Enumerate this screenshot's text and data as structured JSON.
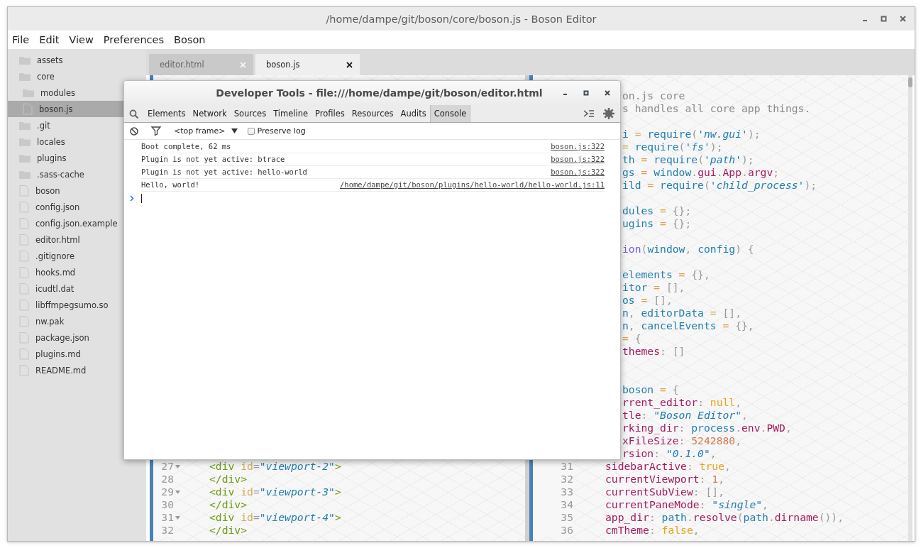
{
  "window": {
    "title": "/home/dampe/git/boson/core/boson.js - Boson Editor"
  },
  "menu": [
    "File",
    "Edit",
    "View",
    "Preferences",
    "Boson"
  ],
  "sidebar": {
    "items": [
      {
        "label": "assets",
        "kind": "folder",
        "selected": false
      },
      {
        "label": "core",
        "kind": "folder",
        "selected": false,
        "children": [
          {
            "label": "modules",
            "kind": "folder",
            "selected": false
          },
          {
            "label": "boson.js",
            "kind": "file",
            "selected": true
          }
        ]
      },
      {
        "label": ".git",
        "kind": "folder",
        "selected": false
      },
      {
        "label": "locales",
        "kind": "folder",
        "selected": false
      },
      {
        "label": "plugins",
        "kind": "folder",
        "selected": false
      },
      {
        "label": ".sass-cache",
        "kind": "folder",
        "selected": false
      },
      {
        "label": "boson",
        "kind": "file",
        "selected": false
      },
      {
        "label": "config.json",
        "kind": "file",
        "selected": false
      },
      {
        "label": "config.json.example",
        "kind": "file",
        "selected": false
      },
      {
        "label": "editor.html",
        "kind": "file",
        "selected": false
      },
      {
        "label": ".gitignore",
        "kind": "file",
        "selected": false
      },
      {
        "label": "hooks.md",
        "kind": "file",
        "selected": false
      },
      {
        "label": "icudtl.dat",
        "kind": "file",
        "selected": false
      },
      {
        "label": "libffmpegsumo.so",
        "kind": "file",
        "selected": false
      },
      {
        "label": "nw.pak",
        "kind": "file",
        "selected": false
      },
      {
        "label": "package.json",
        "kind": "file",
        "selected": false
      },
      {
        "label": "plugins.md",
        "kind": "file",
        "selected": false
      },
      {
        "label": "README.md",
        "kind": "file",
        "selected": false
      }
    ]
  },
  "tabs": [
    {
      "label": "editor.html",
      "selected": false
    },
    {
      "label": "boson.js",
      "selected": true
    }
  ],
  "editors": [
    {
      "lines": [
        {
          "number": "27",
          "foldable": true,
          "tokens": [
            {
              "kind": "tag",
              "text": "<div"
            },
            {
              "kind": "attr",
              "text": " id"
            },
            {
              "kind": "punct",
              "text": "="
            },
            {
              "kind": "string",
              "text": "\"viewport-2\""
            },
            {
              "kind": "tag",
              "text": ">"
            }
          ]
        },
        {
          "number": "28",
          "foldable": false,
          "tokens": [
            {
              "kind": "tag",
              "text": "</div>"
            }
          ]
        },
        {
          "number": "29",
          "foldable": true,
          "tokens": [
            {
              "kind": "tag",
              "text": "<div"
            },
            {
              "kind": "attr",
              "text": " id"
            },
            {
              "kind": "punct",
              "text": "="
            },
            {
              "kind": "string",
              "text": "\"viewport-3\""
            },
            {
              "kind": "tag",
              "text": ">"
            }
          ]
        },
        {
          "number": "30",
          "foldable": false,
          "tokens": [
            {
              "kind": "tag",
              "text": "</div>"
            }
          ]
        },
        {
          "number": "31",
          "foldable": true,
          "tokens": [
            {
              "kind": "tag",
              "text": "<div"
            },
            {
              "kind": "attr",
              "text": " id"
            },
            {
              "kind": "punct",
              "text": "="
            },
            {
              "kind": "string",
              "text": "\"viewport-4\""
            },
            {
              "kind": "tag",
              "text": ">"
            }
          ]
        },
        {
          "number": "32",
          "foldable": false,
          "tokens": [
            {
              "kind": "tag",
              "text": "</div>"
            }
          ]
        }
      ]
    },
    {
      "lines": [
        {
          "tokens": [
            {
              "kind": "comment",
              "text": "on.js core"
            }
          ]
        },
        {
          "tokens": [
            {
              "kind": "comment",
              "text": "s handles all core app things."
            }
          ]
        },
        {
          "kind": "blank"
        },
        {
          "tokens": [
            {
              "kind": "def",
              "text": "i"
            },
            {
              "kind": "op",
              "text": " = "
            },
            {
              "kind": "def",
              "text": "require"
            },
            {
              "kind": "punct",
              "text": "("
            },
            {
              "kind": "string",
              "text": "'nw.gui'"
            },
            {
              "kind": "punct",
              "text": ");"
            }
          ]
        },
        {
          "tokens": [
            {
              "kind": "op",
              "text": "= "
            },
            {
              "kind": "def",
              "text": "require"
            },
            {
              "kind": "punct",
              "text": "("
            },
            {
              "kind": "string",
              "text": "'fs'"
            },
            {
              "kind": "punct",
              "text": ");"
            }
          ]
        },
        {
          "tokens": [
            {
              "kind": "def",
              "text": "th"
            },
            {
              "kind": "op",
              "text": " = "
            },
            {
              "kind": "def",
              "text": "require"
            },
            {
              "kind": "punct",
              "text": "("
            },
            {
              "kind": "string",
              "text": "'path'"
            },
            {
              "kind": "punct",
              "text": ");"
            }
          ]
        },
        {
          "tokens": [
            {
              "kind": "def",
              "text": "gs"
            },
            {
              "kind": "op",
              "text": " = "
            },
            {
              "kind": "def",
              "text": "window"
            },
            {
              "kind": "punct",
              "text": "."
            },
            {
              "kind": "prop",
              "text": "gui"
            },
            {
              "kind": "punct",
              "text": "."
            },
            {
              "kind": "prop",
              "text": "App"
            },
            {
              "kind": "punct",
              "text": "."
            },
            {
              "kind": "prop",
              "text": "argv"
            },
            {
              "kind": "punct",
              "text": ";"
            }
          ]
        },
        {
          "tokens": [
            {
              "kind": "def",
              "text": "ild"
            },
            {
              "kind": "op",
              "text": " = "
            },
            {
              "kind": "def",
              "text": "require"
            },
            {
              "kind": "punct",
              "text": "("
            },
            {
              "kind": "string",
              "text": "'child_process'"
            },
            {
              "kind": "punct",
              "text": ");"
            }
          ]
        },
        {
          "kind": "blank"
        },
        {
          "tokens": [
            {
              "kind": "def",
              "text": "dules"
            },
            {
              "kind": "op",
              "text": " = "
            },
            {
              "kind": "punct",
              "text": "{};"
            }
          ]
        },
        {
          "tokens": [
            {
              "kind": "def",
              "text": "ugins"
            },
            {
              "kind": "op",
              "text": " = "
            },
            {
              "kind": "punct",
              "text": "{};"
            }
          ]
        },
        {
          "kind": "blank"
        },
        {
          "tokens": [
            {
              "kind": "keyword",
              "text": "ion"
            },
            {
              "kind": "punct",
              "text": "("
            },
            {
              "kind": "def",
              "text": "window"
            },
            {
              "kind": "punct",
              "text": ", "
            },
            {
              "kind": "def",
              "text": "config"
            },
            {
              "kind": "punct",
              "text": ") {"
            }
          ]
        },
        {
          "kind": "blank"
        },
        {
          "tokens": [
            {
              "kind": "def",
              "text": "elements"
            },
            {
              "kind": "op",
              "text": " = "
            },
            {
              "kind": "punct",
              "text": "{},"
            }
          ]
        },
        {
          "tokens": [
            {
              "kind": "def",
              "text": "itor"
            },
            {
              "kind": "op",
              "text": " = "
            },
            {
              "kind": "punct",
              "text": "[],"
            }
          ]
        },
        {
          "tokens": [
            {
              "kind": "def",
              "text": "os"
            },
            {
              "kind": "op",
              "text": " = "
            },
            {
              "kind": "punct",
              "text": "[],"
            }
          ]
        },
        {
          "tokens": [
            {
              "kind": "def",
              "text": "n"
            },
            {
              "kind": "punct",
              "text": ", "
            },
            {
              "kind": "def",
              "text": "editorData"
            },
            {
              "kind": "op",
              "text": " = "
            },
            {
              "kind": "punct",
              "text": "[],"
            }
          ]
        },
        {
          "tokens": [
            {
              "kind": "def",
              "text": "n"
            },
            {
              "kind": "punct",
              "text": ", "
            },
            {
              "kind": "def",
              "text": "cancelEvents"
            },
            {
              "kind": "op",
              "text": " = "
            },
            {
              "kind": "punct",
              "text": "{},"
            }
          ]
        },
        {
          "tokens": [
            {
              "kind": "op",
              "text": "= "
            },
            {
              "kind": "punct",
              "text": "{"
            }
          ]
        },
        {
          "tokens": [
            {
              "kind": "prop",
              "text": "themes"
            },
            {
              "kind": "punct",
              "text": ": []"
            }
          ]
        },
        {
          "kind": "blank"
        },
        {
          "kind": "blank"
        },
        {
          "tokens": [
            {
              "kind": "def",
              "text": "boson"
            },
            {
              "kind": "op",
              "text": " = "
            },
            {
              "kind": "punct",
              "text": "{"
            }
          ]
        },
        {
          "tokens": [
            {
              "kind": "prop",
              "text": "rrent_editor"
            },
            {
              "kind": "punct",
              "text": ": "
            },
            {
              "kind": "atom",
              "text": "null"
            },
            {
              "kind": "punct",
              "text": ","
            }
          ]
        },
        {
          "tokens": [
            {
              "kind": "prop",
              "text": "tle"
            },
            {
              "kind": "punct",
              "text": ": "
            },
            {
              "kind": "string",
              "text": "\"Boson Editor\""
            },
            {
              "kind": "punct",
              "text": ","
            }
          ]
        },
        {
          "tokens": [
            {
              "kind": "prop",
              "text": "rking_dir"
            },
            {
              "kind": "punct",
              "text": ": "
            },
            {
              "kind": "def",
              "text": "process"
            },
            {
              "kind": "punct",
              "text": "."
            },
            {
              "kind": "prop",
              "text": "env"
            },
            {
              "kind": "punct",
              "text": "."
            },
            {
              "kind": "prop",
              "text": "PWD"
            },
            {
              "kind": "punct",
              "text": ","
            }
          ]
        },
        {
          "tokens": [
            {
              "kind": "prop",
              "text": "xFileSize"
            },
            {
              "kind": "punct",
              "text": ": "
            },
            {
              "kind": "number",
              "text": "5242880"
            },
            {
              "kind": "punct",
              "text": ","
            }
          ]
        },
        {
          "tokens": [
            {
              "kind": "prop",
              "text": "rsion"
            },
            {
              "kind": "punct",
              "text": ": "
            },
            {
              "kind": "string",
              "text": "\"0.1.0\""
            },
            {
              "kind": "punct",
              "text": ","
            }
          ]
        },
        {
          "number": "31",
          "tokens": [
            {
              "kind": "prop",
              "text": "sidebarActive"
            },
            {
              "kind": "punct",
              "text": ": "
            },
            {
              "kind": "atom",
              "text": "true"
            },
            {
              "kind": "punct",
              "text": ","
            }
          ]
        },
        {
          "number": "32",
          "tokens": [
            {
              "kind": "prop",
              "text": "currentViewport"
            },
            {
              "kind": "punct",
              "text": ": "
            },
            {
              "kind": "number",
              "text": "1"
            },
            {
              "kind": "punct",
              "text": ","
            }
          ]
        },
        {
          "number": "33",
          "tokens": [
            {
              "kind": "prop",
              "text": "currentSubView"
            },
            {
              "kind": "punct",
              "text": ": [],"
            }
          ]
        },
        {
          "number": "34",
          "tokens": [
            {
              "kind": "prop",
              "text": "currentPaneMode"
            },
            {
              "kind": "punct",
              "text": ": "
            },
            {
              "kind": "string",
              "text": "\"single\""
            },
            {
              "kind": "punct",
              "text": ","
            }
          ]
        },
        {
          "number": "35",
          "tokens": [
            {
              "kind": "prop",
              "text": "app_dir"
            },
            {
              "kind": "punct",
              "text": ": "
            },
            {
              "kind": "def",
              "text": "path"
            },
            {
              "kind": "punct",
              "text": "."
            },
            {
              "kind": "prop",
              "text": "resolve"
            },
            {
              "kind": "punct",
              "text": "("
            },
            {
              "kind": "def",
              "text": "path"
            },
            {
              "kind": "punct",
              "text": "."
            },
            {
              "kind": "prop",
              "text": "dirname"
            },
            {
              "kind": "punct",
              "text": "()),"
            }
          ]
        },
        {
          "number": "36",
          "tokens": [
            {
              "kind": "prop",
              "text": "cmTheme"
            },
            {
              "kind": "punct",
              "text": ": "
            },
            {
              "kind": "atom",
              "text": "false"
            },
            {
              "kind": "punct",
              "text": ","
            }
          ]
        }
      ]
    }
  ],
  "devtools": {
    "title": "Developer Tools - file:///home/dampe/git/boson/editor.html",
    "panels": [
      {
        "label": "Elements",
        "selected": false
      },
      {
        "label": "Network",
        "selected": false
      },
      {
        "label": "Sources",
        "selected": false
      },
      {
        "label": "Timeline",
        "selected": false
      },
      {
        "label": "Profiles",
        "selected": false
      },
      {
        "label": "Resources",
        "selected": false
      },
      {
        "label": "Audits",
        "selected": false
      },
      {
        "label": "Console",
        "selected": true
      }
    ],
    "frame": "<top frame>",
    "preserve_log": {
      "label": "Preserve log",
      "checked": false
    },
    "messages": [
      {
        "text": "Boot complete, 62 ms",
        "source": "boson.js:322"
      },
      {
        "text": "Plugin is not yet active: btrace",
        "source": "boson.js:322"
      },
      {
        "text": "Plugin is not yet active: hello-world",
        "source": "boson.js:322"
      },
      {
        "text": "Hello, world!",
        "source": "/home/dampe/git/boson/plugins/hello-world/hello-world.js:11"
      }
    ]
  }
}
